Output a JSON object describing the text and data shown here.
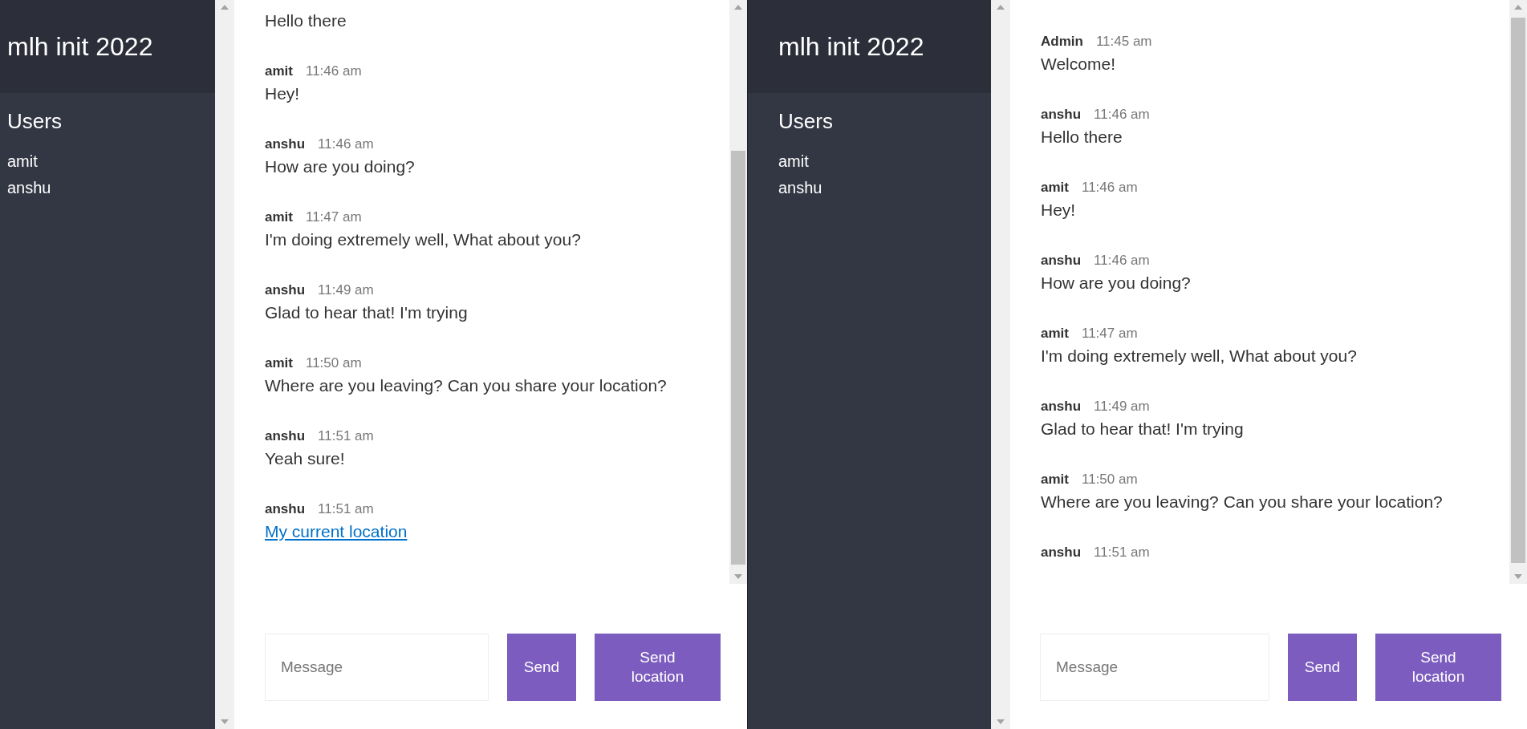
{
  "windows": [
    {
      "title": "mlh init 2022",
      "users_heading": "Users",
      "users": [
        "amit",
        "anshu"
      ],
      "messages": [
        {
          "kind": "text",
          "text": "Hello there"
        },
        {
          "kind": "text",
          "author": "amit",
          "time": "11:46 am",
          "text": "Hey!"
        },
        {
          "kind": "text",
          "author": "anshu",
          "time": "11:46 am",
          "text": "How are you doing?"
        },
        {
          "kind": "text",
          "author": "amit",
          "time": "11:47 am",
          "text": "I'm doing extremely well, What about you?"
        },
        {
          "kind": "text",
          "author": "anshu",
          "time": "11:49 am",
          "text": "Glad to hear that! I'm trying"
        },
        {
          "kind": "text",
          "author": "amit",
          "time": "11:50 am",
          "text": "Where are you leaving? Can you share your location?"
        },
        {
          "kind": "text",
          "author": "anshu",
          "time": "11:51 am",
          "text": "Yeah sure!"
        },
        {
          "kind": "link",
          "author": "anshu",
          "time": "11:51 am",
          "text": "My current location"
        }
      ],
      "composer": {
        "placeholder": "Message",
        "send": "Send",
        "send_location": "Send location"
      }
    },
    {
      "title": "mlh init 2022",
      "users_heading": "Users",
      "users": [
        "amit",
        "anshu"
      ],
      "messages": [
        {
          "kind": "text",
          "author": "Admin",
          "time": "11:45 am",
          "text": "Welcome!"
        },
        {
          "kind": "text",
          "author": "anshu",
          "time": "11:46 am",
          "text": "Hello there"
        },
        {
          "kind": "text",
          "author": "amit",
          "time": "11:46 am",
          "text": "Hey!"
        },
        {
          "kind": "text",
          "author": "anshu",
          "time": "11:46 am",
          "text": "How are you doing?"
        },
        {
          "kind": "text",
          "author": "amit",
          "time": "11:47 am",
          "text": "I'm doing extremely well, What about you?"
        },
        {
          "kind": "text",
          "author": "anshu",
          "time": "11:49 am",
          "text": "Glad to hear that! I'm trying"
        },
        {
          "kind": "text",
          "author": "amit",
          "time": "11:50 am",
          "text": "Where are you leaving? Can you share your location?"
        },
        {
          "kind": "header",
          "author": "anshu",
          "time": "11:51 am"
        }
      ],
      "composer": {
        "placeholder": "Message",
        "send": "Send",
        "send_location": "Send location"
      }
    }
  ]
}
